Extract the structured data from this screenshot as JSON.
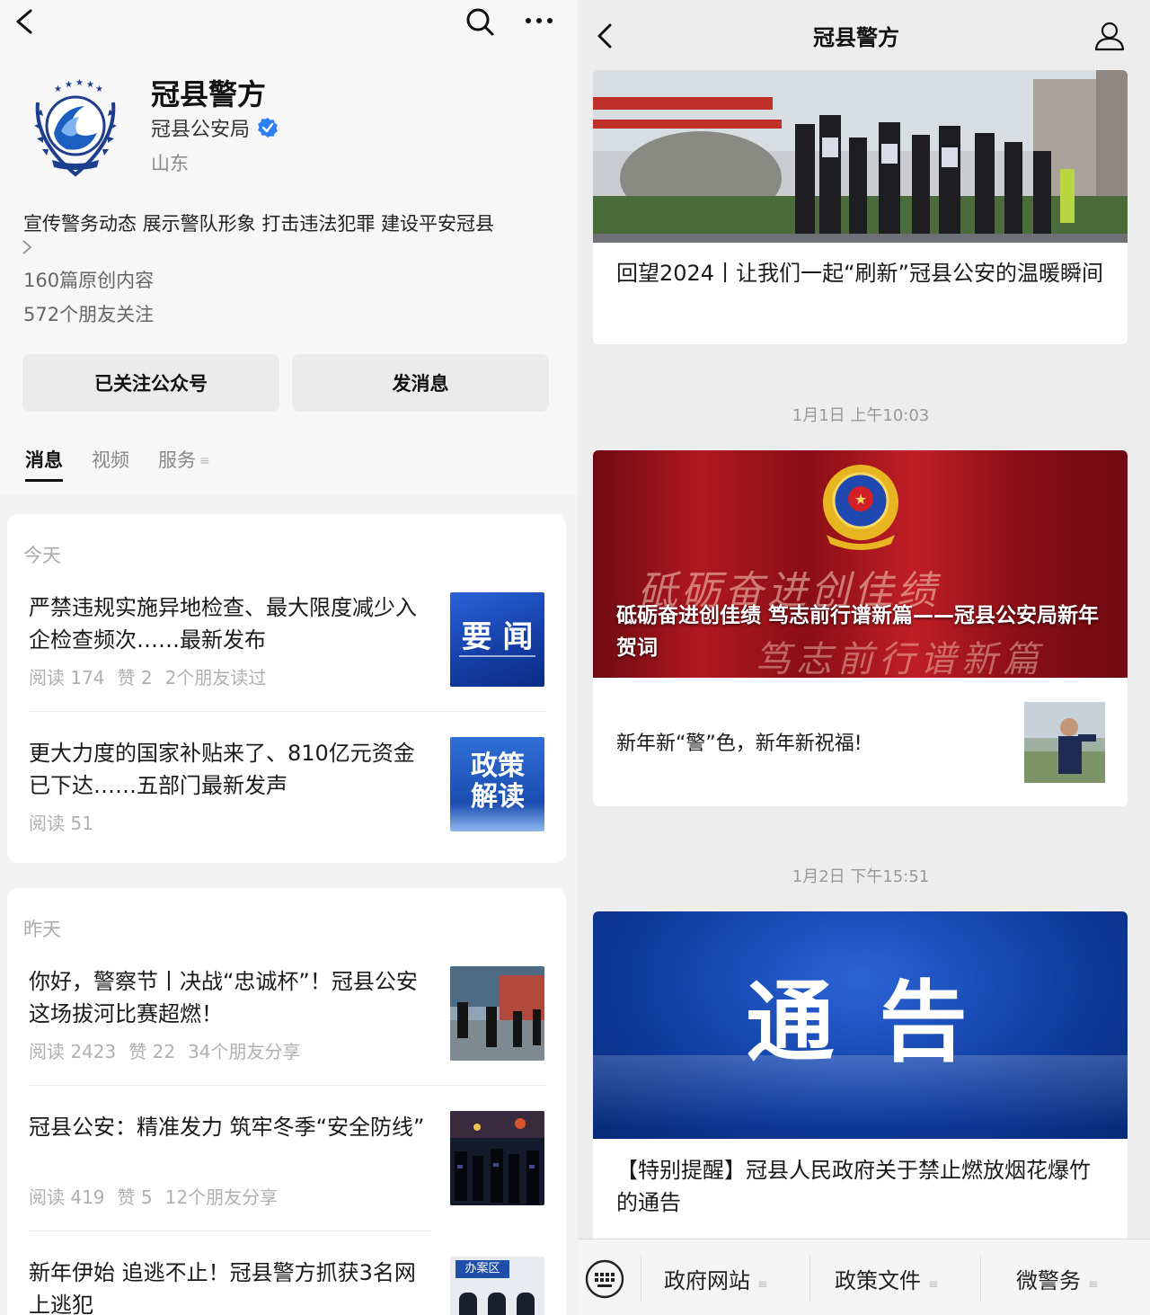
{
  "profile": {
    "name": "冠县警方",
    "owner": "冠县公安局",
    "region": "山东",
    "description": "宣传警务动态  展示警队形象  打击违法犯罪  建设平安冠县",
    "original_count": "160篇原创内容",
    "friends_following": "572个朋友关注",
    "follow_button": "已关注公众号",
    "message_button": "发消息"
  },
  "tabs": [
    "消息",
    "视频",
    "服务"
  ],
  "today": {
    "label": "今天",
    "articles": [
      {
        "title": "严禁违规实施异地检查、最大限度减少入企检查频次……最新发布",
        "meta": [
          "阅读 174",
          "赞 2",
          "2个朋友读过"
        ],
        "thumb_text": "要 闻"
      },
      {
        "title": "更大力度的国家补贴来了、810亿元资金已下达……五部门最新发声",
        "meta": [
          "阅读 51"
        ],
        "thumb_text": "政策解读"
      }
    ]
  },
  "yesterday": {
    "label": "昨天",
    "articles": [
      {
        "title": "你好，警察节丨决战“忠诚杯”！冠县公安这场拔河比赛超燃！",
        "meta": [
          "阅读 2423",
          "赞 22",
          "34个朋友分享"
        ]
      },
      {
        "title": "冠县公安：精准发力 筑牢冬季“安全防线”",
        "meta": [
          "阅读 419",
          "赞 5",
          "12个朋友分享"
        ]
      },
      {
        "title": "新年伊始 追逃不止！冠县警方抓获3名网上逃犯",
        "meta": [],
        "thumb_text": "办案区"
      }
    ]
  },
  "chat": {
    "title": "冠县警方",
    "card1_title": "回望2024丨让我们一起“刷新”冠县公安的温暖瞬间",
    "ts1": "1月1日 上午10:03",
    "card2_overlay": "砥砺奋进创佳绩 笃志前行谱新篇——冠县公安局新年贺词",
    "card2_banner_top": "砥砺奋进创佳绩",
    "card2_banner_bottom": "笃志前行谱新篇",
    "card2_sub": "新年新“警”色，新年新祝福!",
    "ts2": "1月2日 下午15:51",
    "card3_banner": "通 告",
    "card3_title": "【特别提醒】冠县人民政府关于禁止燃放烟花爆竹的通告",
    "menu": [
      "政府网站",
      "政策文件",
      "微警务"
    ]
  },
  "colors": {
    "verified": "#2e7ff5",
    "police_red": "#a8131a",
    "notice_blue": "#0d3b9c",
    "news_blue": "#1540a8"
  }
}
